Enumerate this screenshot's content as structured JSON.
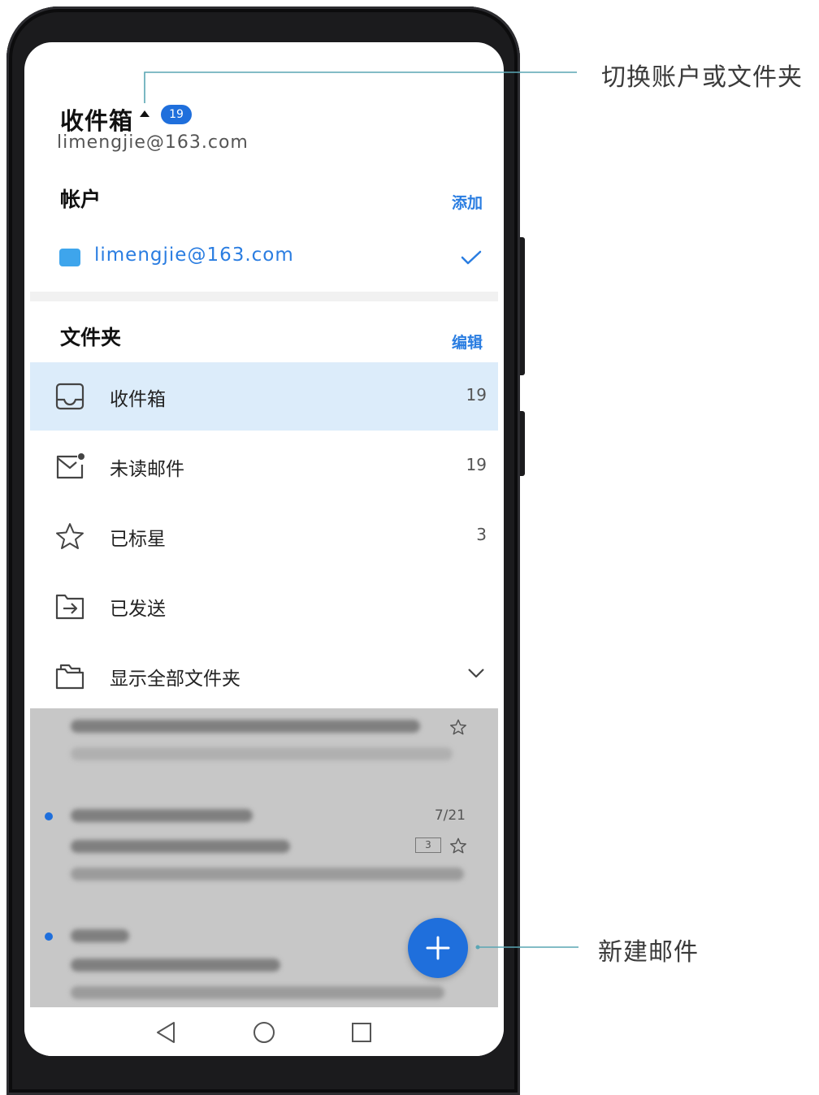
{
  "header": {
    "title": "收件箱",
    "badge_count": "19",
    "account_email": "limengjie@163.com"
  },
  "accounts": {
    "heading": "帐户",
    "add_label": "添加",
    "items": [
      {
        "email": "limengjie@163.com",
        "color": "#3ea5ec",
        "selected": true
      }
    ]
  },
  "folders": {
    "heading": "文件夹",
    "edit_label": "编辑",
    "items": [
      {
        "label": "收件箱",
        "count": "19",
        "icon": "inbox-icon",
        "active": true
      },
      {
        "label": "未读邮件",
        "count": "19",
        "icon": "unread-mail-icon",
        "active": false
      },
      {
        "label": "已标星",
        "count": "3",
        "icon": "star-icon",
        "active": false
      },
      {
        "label": "已发送",
        "count": "",
        "icon": "sent-icon",
        "active": false
      },
      {
        "label": "显示全部文件夹",
        "count": "",
        "icon": "folder-icon",
        "active": false
      }
    ]
  },
  "background_list": {
    "date": "7/21",
    "count": "3"
  },
  "fab": {
    "icon": "plus-icon"
  },
  "callouts": {
    "switch_account": "切换账户或文件夹",
    "new_mail": "新建邮件"
  },
  "colors": {
    "accent": "#1f6fdc",
    "link": "#2a7de1",
    "active_row": "#dcecfa",
    "callout_line": "#5aa6b4"
  }
}
